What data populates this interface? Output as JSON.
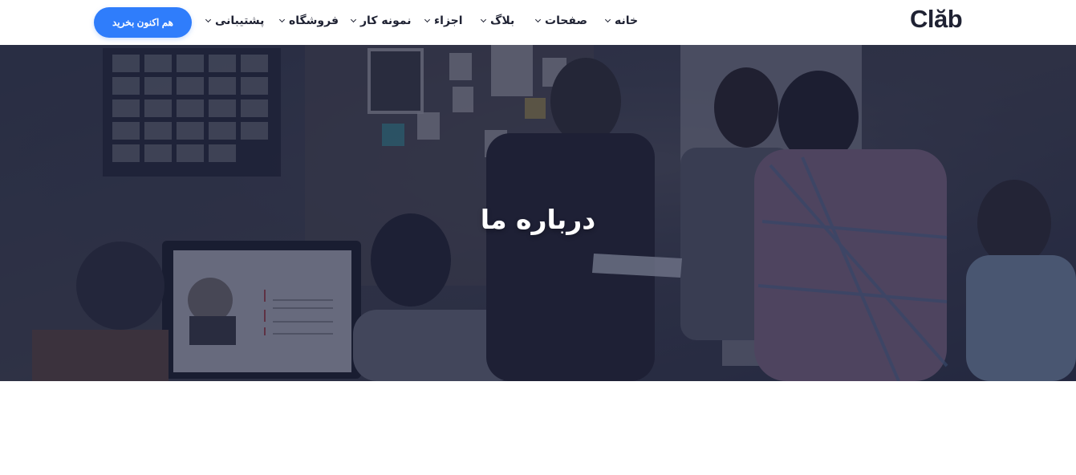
{
  "brand": {
    "logo_text": "Clăb"
  },
  "nav": {
    "items": [
      {
        "label": "خانه"
      },
      {
        "label": "صفحات"
      },
      {
        "label": "بلاگ"
      },
      {
        "label": "اجزاء"
      },
      {
        "label": "نمونه کار"
      },
      {
        "label": "فروشگاه"
      },
      {
        "label": "پشتیبانی"
      }
    ],
    "cta_label": "هم اکنون بخرید"
  },
  "hero": {
    "title": "درباره ما",
    "overlay_color": "#1e2440"
  },
  "colors": {
    "accent": "#2f7dfb",
    "text": "#1f2233",
    "background": "#ffffff"
  },
  "icons": {
    "nav_dropdown": "chevron-down-icon"
  }
}
